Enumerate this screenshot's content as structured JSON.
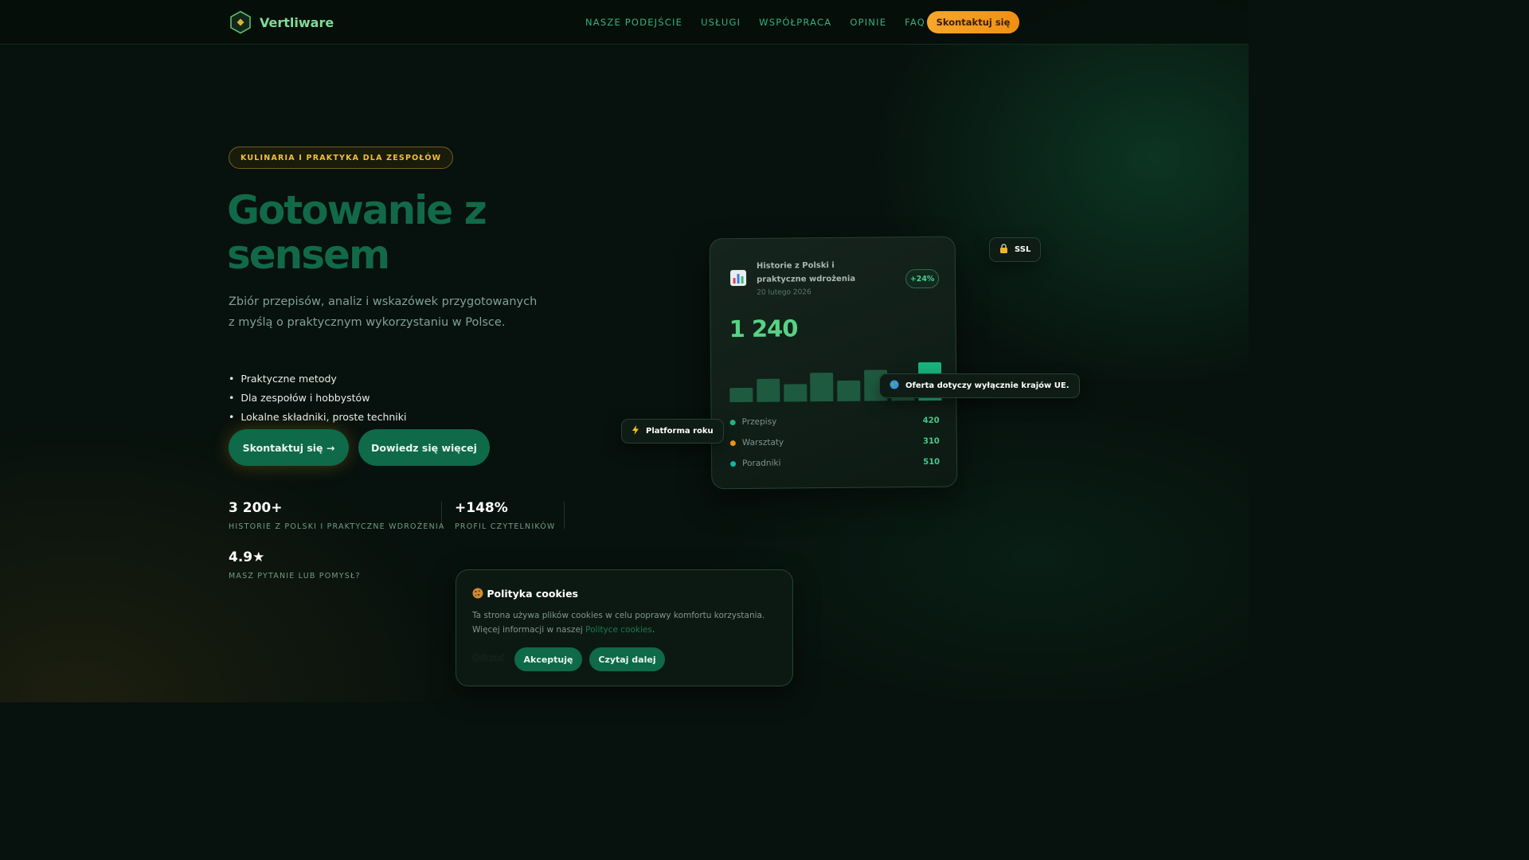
{
  "brand": {
    "name": "Vertliware",
    "icon": "hexagon-diamond-icon"
  },
  "nav": {
    "links": [
      "NASZE PODEJŚCIE",
      "USŁUGI",
      "WSPÓŁPRACA",
      "OPINIE",
      "FAQ"
    ],
    "cta_label": "Skontaktuj się"
  },
  "hero": {
    "badge": "KULINARIA I PRAKTYKA DLA ZESPOŁÓW",
    "title": "Gotowanie z sensem",
    "subtitle": "Zbiór przepisów, analiz i wskazówek przygotowanych z myślą o praktycznym wykorzystaniu w Polsce.",
    "features": [
      "Praktyczne metody",
      "Dla zespołów i hobbystów",
      "Lokalne składniki, proste techniki"
    ],
    "primary_button": "Skontaktuj się →",
    "secondary_button": "Dowiedz się więcej"
  },
  "stats": [
    {
      "value": "3 200+",
      "label": "HISTORIE Z POLSKI I PRAKTYCZNE WDROŻENIA"
    },
    {
      "value": "+148%",
      "label": "PROFIL CZYTELNIKÓW"
    },
    {
      "value": "4.9★",
      "label": "MASZ PYTANIE LUB POMYSŁ?"
    }
  ],
  "card": {
    "icon": "bar-chart-icon",
    "title": "Historie z Polski i praktyczne wdrożenia",
    "date": "20 lutego 2026",
    "change": "+24%",
    "big_value": "1 240",
    "bars": [
      0.33,
      0.52,
      0.4,
      0.65,
      0.48,
      0.7,
      0.55,
      0.88
    ],
    "legend": [
      {
        "label": "Przepisy",
        "value": "420",
        "color": "#1fb87e"
      },
      {
        "label": "Warsztaty",
        "value": "310",
        "color": "#f29a16"
      },
      {
        "label": "Poradniki",
        "value": "510",
        "color": "#15b5a0"
      }
    ]
  },
  "chips": {
    "ssl": {
      "icon": "lock-icon",
      "label": "SSL"
    },
    "eu": {
      "icon": "globe-icon",
      "label": "Oferta dotyczy wyłącznie krajów UE."
    },
    "platform": {
      "icon": "lightning-icon",
      "label": "Platforma roku"
    }
  },
  "cookie": {
    "icon": "cookie-icon",
    "title": "Polityka cookies",
    "text_before": "Ta strona używa plików cookies w celu poprawy komfortu korzystania. Więcej informacji w naszej ",
    "link": "Polityce cookies",
    "text_after": ".",
    "reject": "Odrzuć",
    "accept": "Akceptuję",
    "read_more": "Czytaj dalej"
  }
}
